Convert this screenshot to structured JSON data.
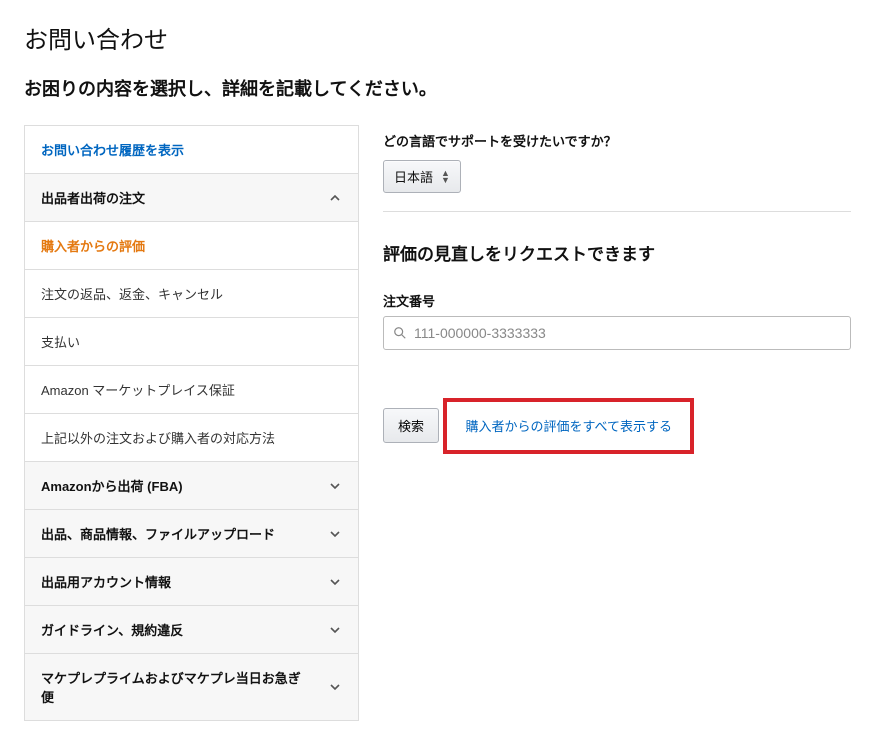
{
  "page": {
    "title": "お問い合わせ",
    "subtitle": "お困りの内容を選択し、詳細を記載してください。"
  },
  "sidebar": {
    "history_link": "お問い合わせ履歴を表示",
    "sections": [
      {
        "label": "出品者出荷の注文",
        "expanded": true,
        "items": [
          {
            "label": "購入者からの評価",
            "active": true
          },
          {
            "label": "注文の返品、返金、キャンセル",
            "active": false
          },
          {
            "label": "支払い",
            "active": false
          },
          {
            "label": "Amazon マーケットプレイス保証",
            "active": false
          },
          {
            "label": "上記以外の注文および購入者の対応方法",
            "active": false
          }
        ]
      },
      {
        "label": "Amazonから出荷 (FBA)",
        "expanded": false
      },
      {
        "label": "出品、商品情報、ファイルアップロード",
        "expanded": false
      },
      {
        "label": "出品用アカウント情報",
        "expanded": false
      },
      {
        "label": "ガイドライン、規約違反",
        "expanded": false
      },
      {
        "label": "マケプレプライムおよびマケプレ当日お急ぎ便",
        "expanded": false
      }
    ]
  },
  "main": {
    "language_label": "どの言語でサポートを受けたいですか？",
    "language_value": "日本語",
    "section_title": "評価の見直しをリクエストできます",
    "order_label": "注文番号",
    "order_placeholder": "111-000000-3333333",
    "search_button": "検索",
    "view_all_link": "購入者からの評価をすべて表示する"
  }
}
